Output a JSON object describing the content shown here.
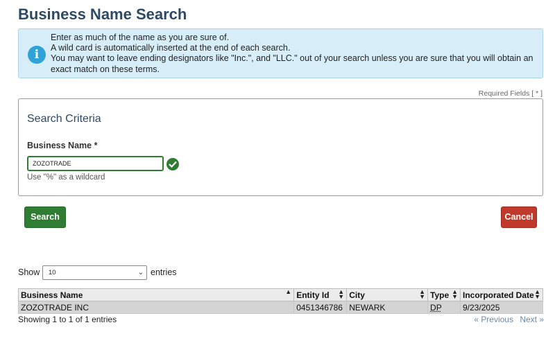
{
  "page": {
    "title": "Business Name Search"
  },
  "info": {
    "lines": [
      "Enter as much of the name as you are sure of.",
      "A wild card is automatically inserted at the end of each search.",
      "You may want to leave ending designators like \"Inc.\", and \"LLC.\" out of your search unless you are sure that you will obtain an exact match on these terms."
    ]
  },
  "required_note": "Required Fields [ * ]",
  "criteria": {
    "title": "Search Criteria",
    "field_label": "Business Name *",
    "value": "ZOZOTRADE",
    "hint": "Use \"%\" as a wildcard"
  },
  "buttons": {
    "search": "Search",
    "cancel": "Cancel"
  },
  "entries": {
    "show": "Show",
    "selected": "10",
    "suffix": "entries"
  },
  "table": {
    "headers": [
      "Business Name",
      "Entity Id",
      "City",
      "Type",
      "Incorporated Date"
    ],
    "rows": [
      [
        "ZOZOTRADE INC",
        "0451346786",
        "NEWARK",
        "DP",
        "9/23/2025"
      ]
    ]
  },
  "summary": "Showing 1 to 1 of 1 entries",
  "pager": {
    "previous": "« Previous",
    "next": "Next »"
  },
  "icons": {
    "info": "info-icon",
    "check": "check-icon"
  },
  "colors": {
    "primary_green": "#2f7d32",
    "cancel_red": "#c0392b",
    "title_blue": "#2c4a66",
    "info_bg": "#d7eef8"
  }
}
